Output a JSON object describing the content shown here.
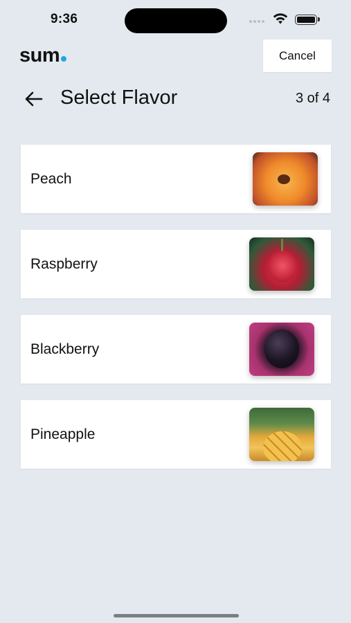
{
  "status_bar": {
    "time": "9:36"
  },
  "app": {
    "logo_text": "sum",
    "accent_color": "#1ea7e3"
  },
  "header": {
    "cancel_label": "Cancel",
    "back_icon": "arrow-left-icon",
    "title": "Select Flavor",
    "step": "3 of 4"
  },
  "flavors": [
    {
      "name": "Peach",
      "image": "peach-image"
    },
    {
      "name": "Raspberry",
      "image": "raspberry-image"
    },
    {
      "name": "Blackberry",
      "image": "blackberry-image"
    },
    {
      "name": "Pineapple",
      "image": "pineapple-image"
    }
  ]
}
